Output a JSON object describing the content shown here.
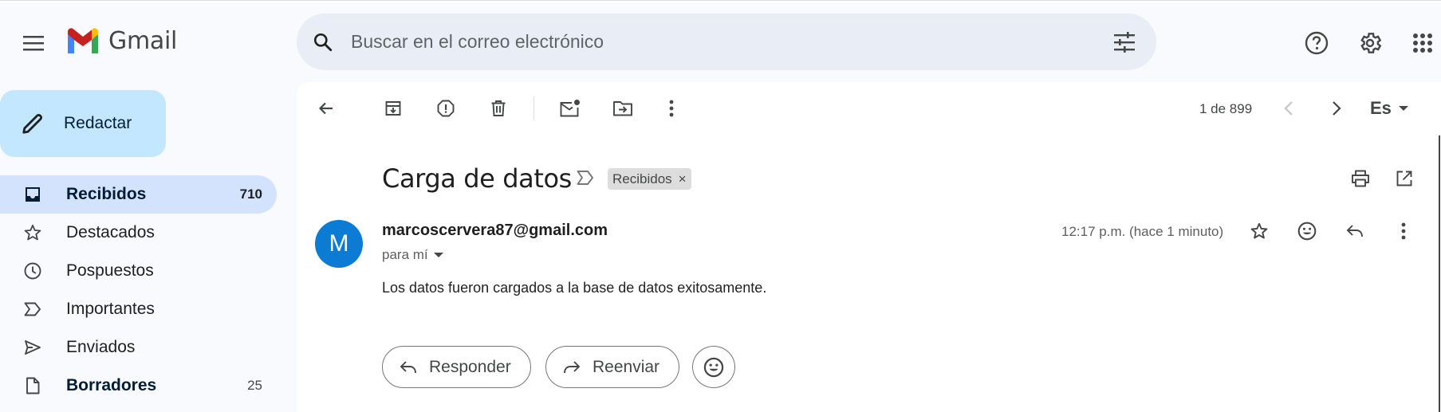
{
  "header": {
    "app_name": "Gmail",
    "search_placeholder": "Buscar en el correo electrónico"
  },
  "sidebar": {
    "compose_label": "Redactar",
    "items": [
      {
        "label": "Recibidos",
        "count": "710",
        "icon": "inbox-icon",
        "active": true,
        "bold": true
      },
      {
        "label": "Destacados",
        "count": "",
        "icon": "star-icon"
      },
      {
        "label": "Pospuestos",
        "count": "",
        "icon": "clock-icon"
      },
      {
        "label": "Importantes",
        "count": "",
        "icon": "important-icon"
      },
      {
        "label": "Enviados",
        "count": "",
        "icon": "send-icon"
      },
      {
        "label": "Borradores",
        "count": "25",
        "icon": "draft-icon",
        "bold": true
      }
    ]
  },
  "toolbar": {
    "pager": "1 de 899",
    "language": "Es"
  },
  "email": {
    "subject": "Carga de datos",
    "label": "Recibidos",
    "label_remove": "×",
    "avatar_letter": "M",
    "sender": "marcoscervera87@gmail.com",
    "to_me": "para mí",
    "time": "12:17 p.m. (hace 1 minuto)",
    "body": "Los datos fueron cargados a la base de datos exitosamente."
  },
  "actions": {
    "reply": "Responder",
    "forward": "Reenviar"
  },
  "colors": {
    "compose_bg": "#c2e7ff",
    "active_nav_bg": "#d3e3fd",
    "search_bg": "#e9eef6",
    "avatar_bg": "#0b7bd3"
  }
}
